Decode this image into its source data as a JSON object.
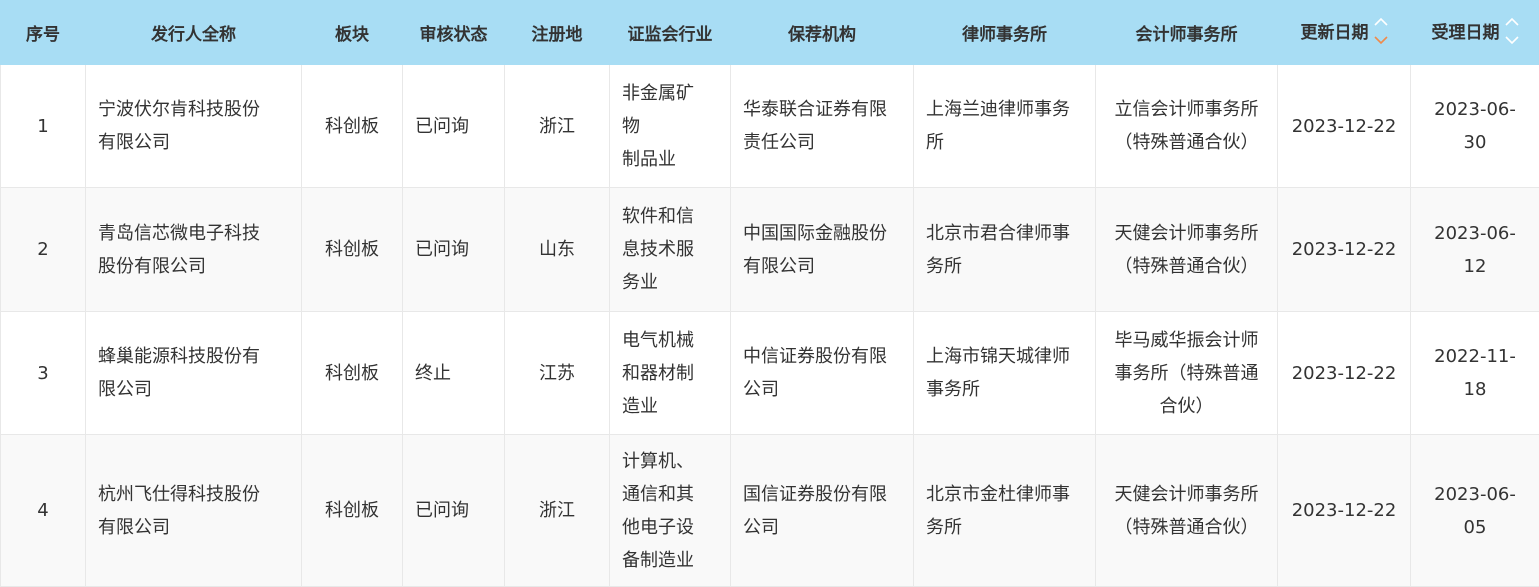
{
  "columns": {
    "seq": "序号",
    "issuer": "发行人全称",
    "board": "板块",
    "status": "审核状态",
    "region": "注册地",
    "industry": "证监会行业",
    "sponsor": "保荐机构",
    "law_firm": "律师事务所",
    "accounting_firm": "会计师事务所",
    "updated": "更新日期",
    "accepted": "受理日期"
  },
  "sort_indicator": {
    "updated": {
      "icon": "sort-up-down-icon",
      "active": "down",
      "active_color": "#f08a4b"
    },
    "accepted": {
      "icon": "sort-up-down-icon",
      "active": "none"
    }
  },
  "rows": [
    {
      "seq": "1",
      "issuer": "宁波伏尔肯科技股份\n有限公司",
      "board": "科创板",
      "status": "已问询",
      "region": "浙江",
      "industry": "非金属矿\n物\n制品业",
      "sponsor": "华泰联合证券有限\n责任公司",
      "law_firm": "上海兰迪律师事务\n所",
      "accounting_firm": "立信会计师事务所\n（特殊普通合伙）",
      "updated": "2023-12-22",
      "accepted": "2023-06-30"
    },
    {
      "seq": "2",
      "issuer": "青岛信芯微电子科技\n股份有限公司",
      "board": "科创板",
      "status": "已问询",
      "region": "山东",
      "industry": "软件和信\n息技术服\n务业",
      "sponsor": "中国国际金融股份\n有限公司",
      "law_firm": "北京市君合律师事\n务所",
      "accounting_firm": "天健会计师事务所\n（特殊普通合伙）",
      "updated": "2023-12-22",
      "accepted": "2023-06-12"
    },
    {
      "seq": "3",
      "issuer": "蜂巢能源科技股份有\n限公司",
      "board": "科创板",
      "status": "终止",
      "region": "江苏",
      "industry": "电气机械\n和器材制\n造业",
      "sponsor": "中信证券股份有限\n公司",
      "law_firm": "上海市锦天城律师\n事务所",
      "accounting_firm": "毕马威华振会计师\n事务所（特殊普通\n合伙）",
      "updated": "2023-12-22",
      "accepted": "2022-11-18"
    },
    {
      "seq": "4",
      "issuer": "杭州飞仕得科技股份\n有限公司",
      "board": "科创板",
      "status": "已问询",
      "region": "浙江",
      "industry": "计算机、\n通信和其\n他电子设\n备制造业",
      "sponsor": "国信证券股份有限\n公司",
      "law_firm": "北京市金杜律师事\n务所",
      "accounting_firm": "天健会计师事务所\n（特殊普通合伙）",
      "updated": "2023-12-22",
      "accepted": "2023-06-05"
    }
  ]
}
